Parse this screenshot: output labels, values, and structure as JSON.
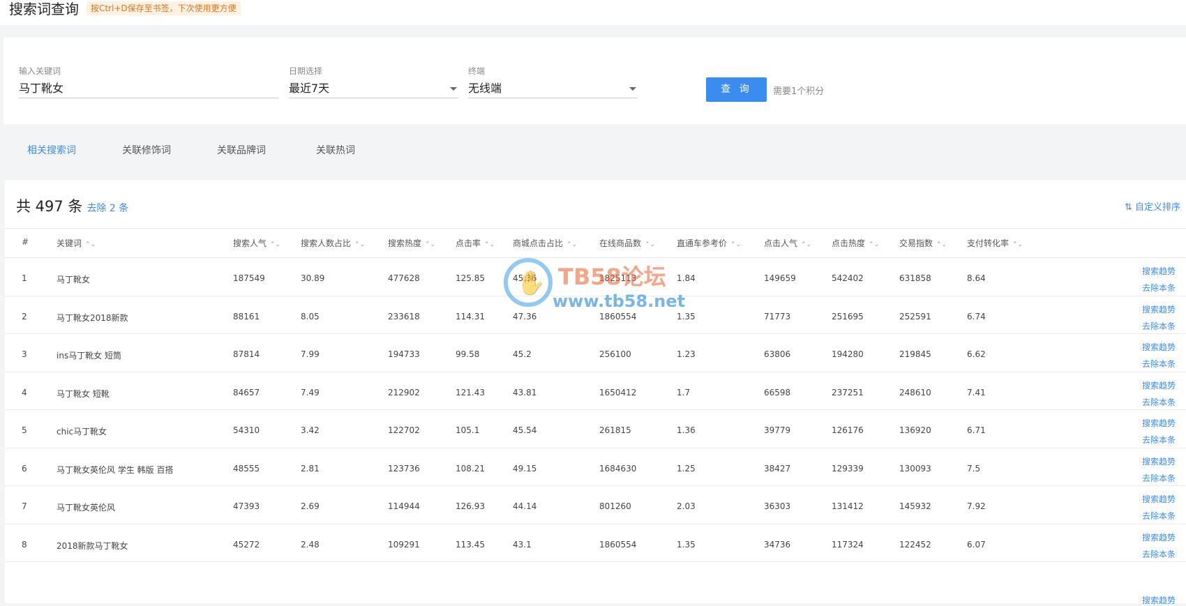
{
  "header": {
    "title": "搜索词查询",
    "bookmark_tip": "按Ctrl+D保存至书签，下次使用更方便"
  },
  "query": {
    "keyword_label": "输入关键词",
    "keyword_value": "马丁靴女",
    "date_label": "日期选择",
    "date_value": "最近7天",
    "terminal_label": "终端",
    "terminal_value": "无线端",
    "button_label": "查 询",
    "cost_note": "需要1个积分"
  },
  "tabs": [
    {
      "label": "相关搜索词",
      "active": true
    },
    {
      "label": "关联修饰词",
      "active": false
    },
    {
      "label": "关联品牌词",
      "active": false
    },
    {
      "label": "关联热词",
      "active": false
    }
  ],
  "results": {
    "total_text": "共 497 条",
    "remove_text": "去除 2 条",
    "custom_sort": "自定义排序",
    "sort_icon": "⌃⌄",
    "columns": [
      "#",
      "关键词",
      "搜索人气",
      "搜索人数占比",
      "搜索热度",
      "点击率",
      "商城点击占比",
      "在线商品数",
      "直通车参考价",
      "点击人气",
      "点击热度",
      "交易指数",
      "支付转化率"
    ],
    "actions": {
      "trend": "搜索趋势",
      "remove": "去除本条"
    },
    "rows": [
      [
        "1",
        "马丁靴女",
        "187549",
        "30.89",
        "477628",
        "125.85",
        "45.36",
        "1825113",
        "1.84",
        "149659",
        "542402",
        "631858",
        "8.64"
      ],
      [
        "2",
        "马丁靴女2018新款",
        "88161",
        "8.05",
        "233618",
        "114.31",
        "47.36",
        "1860554",
        "1.35",
        "71773",
        "251695",
        "252591",
        "6.74"
      ],
      [
        "3",
        "ins马丁靴女 短筒",
        "87814",
        "7.99",
        "194733",
        "99.58",
        "45.2",
        "256100",
        "1.23",
        "63806",
        "194280",
        "219845",
        "6.62"
      ],
      [
        "4",
        "马丁靴女 短靴",
        "84657",
        "7.49",
        "212902",
        "121.43",
        "43.81",
        "1650412",
        "1.7",
        "66598",
        "237251",
        "248610",
        "7.41"
      ],
      [
        "5",
        "chic马丁靴女",
        "54310",
        "3.42",
        "122702",
        "105.1",
        "45.54",
        "261815",
        "1.36",
        "39779",
        "126176",
        "136920",
        "6.71"
      ],
      [
        "6",
        "马丁靴女英伦风 学生 韩版 百搭",
        "48555",
        "2.81",
        "123736",
        "108.21",
        "49.15",
        "1684630",
        "1.25",
        "38427",
        "129339",
        "130093",
        "7.5"
      ],
      [
        "7",
        "马丁靴女英伦风",
        "47393",
        "2.69",
        "114944",
        "126.93",
        "44.14",
        "801260",
        "2.03",
        "36303",
        "131412",
        "145932",
        "7.92"
      ],
      [
        "8",
        "2018新款马丁靴女",
        "45272",
        "2.48",
        "109291",
        "113.45",
        "43.1",
        "1860554",
        "1.35",
        "34736",
        "117324",
        "122452",
        "6.07"
      ]
    ],
    "partial_row_action": "搜索趋势"
  },
  "watermark": {
    "title": "TB58论坛",
    "url": "www.tb58.net"
  },
  "colors": {
    "accent": "#3b8cf0",
    "tip_bg": "#fdf1e2",
    "tip_text": "#e07420",
    "watermark_orange": "#f26b3a",
    "watermark_blue": "#1e88d8"
  }
}
